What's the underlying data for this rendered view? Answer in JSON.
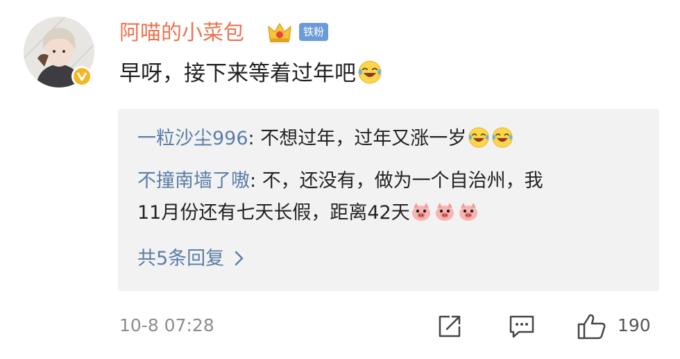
{
  "post": {
    "username": "阿喵的小菜包",
    "fan_badge": "铁粉",
    "content": "早呀，接下来等着过年吧",
    "timestamp": "10-8 07:28",
    "like_count": "190"
  },
  "replies": [
    {
      "name": "一粒沙尘996",
      "sep": ": ",
      "text": "不想过年，过年又涨一岁"
    },
    {
      "name": "不撞南墙了嗷",
      "sep": ": ",
      "text_line1": "不，还没有，做为一个自治州，我",
      "text_line2": "11月份还有七天长假，距离42天"
    }
  ],
  "more_replies": "共5条回复",
  "icons": [
    "avatar",
    "verified-v-icon",
    "crown-icon",
    "laugh-cry-emoji",
    "pig-emoji",
    "chevron-right-icon",
    "share-icon",
    "comment-icon",
    "like-icon"
  ],
  "colors": {
    "username": "#eb7350",
    "reply_name": "#5b7da8",
    "badge": "#6a9bd8",
    "verified": "#f5b623",
    "reply_bg": "#f2f2f2"
  }
}
